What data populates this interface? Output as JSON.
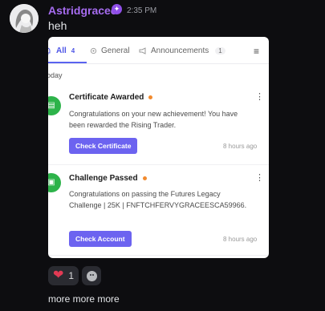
{
  "message": {
    "username": "Astridgracee",
    "badge": "✦",
    "time": "2:35 PM",
    "text": "heh",
    "footer_text": "more more more"
  },
  "notification_panel": {
    "tabs": [
      {
        "label": "All",
        "count": "4",
        "active": true
      },
      {
        "label": "General"
      },
      {
        "label": "Announcements",
        "count": "1"
      }
    ],
    "menu_icon": "hamburger-icon",
    "day_label": "oday",
    "items": [
      {
        "title": "Certificate Awarded",
        "body": "Congratulations on your new achievement! You have been rewarded the Rising Trader.",
        "button": "Check Certificate",
        "time": "8 hours ago",
        "icon": "certificate-icon"
      },
      {
        "title": "Challenge Passed",
        "body": "Congratulations on passing the Futures Legacy Challenge | 25K | FNFTCHFERVYGRACEESCA59966.",
        "button": "Check Account",
        "time": "8 hours ago",
        "icon": "challenge-icon"
      }
    ]
  },
  "reactions": [
    {
      "emoji": "❤",
      "count": "1"
    }
  ],
  "colors": {
    "background": "#0d0d10",
    "username": "#a66cf0",
    "accent_button": "#6c63f0",
    "success_icon": "#2db34a",
    "unread_dot": "#f28a2e"
  }
}
